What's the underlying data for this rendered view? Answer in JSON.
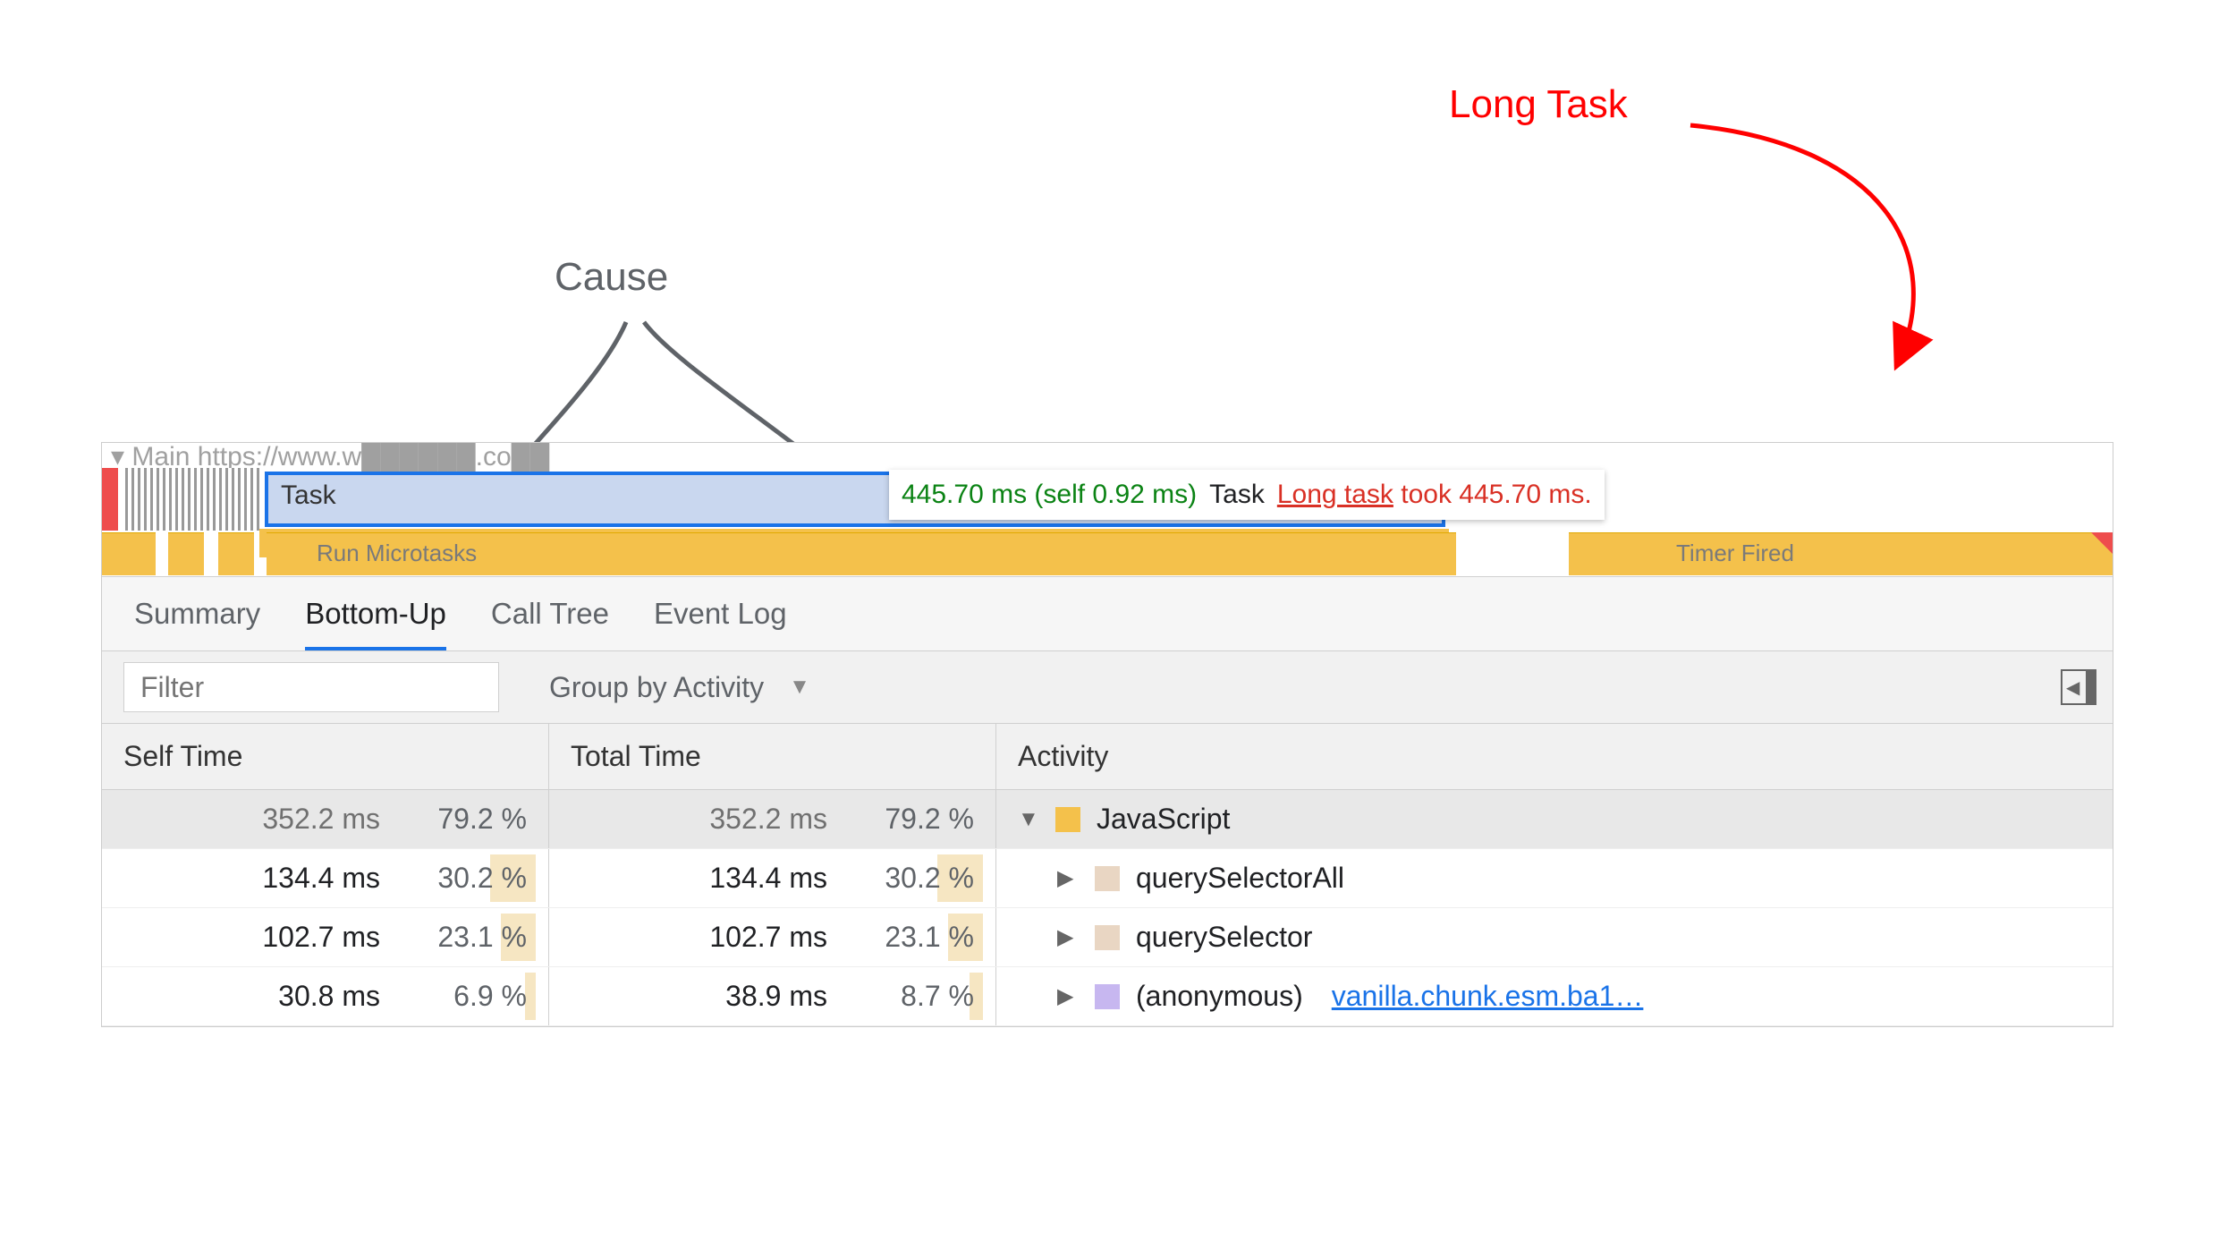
{
  "annotations": {
    "long_task": "Long Task",
    "cause": "Cause"
  },
  "flame": {
    "url_prefix": "▾ Main   https://www.w██████.co██",
    "task_label": "Task",
    "popup": {
      "time": "445.70 ms (self 0.92 ms)",
      "name": "Task",
      "warn_prefix": "Long task",
      "warn_suffix": " took 445.70 ms."
    },
    "sub_left": "Run Microtasks",
    "sub_right": "Timer Fired"
  },
  "tabs": [
    "Summary",
    "Bottom-Up",
    "Call Tree",
    "Event Log"
  ],
  "selected_tab": 1,
  "filter": {
    "placeholder": "Filter",
    "group_label": "Group by Activity"
  },
  "columns": [
    "Self Time",
    "Total Time",
    "Activity"
  ],
  "rows": [
    {
      "self_ms": "352.2 ms",
      "self_pct": "79.2 %",
      "self_bar": 0,
      "total_ms": "352.2 ms",
      "total_pct": "79.2 %",
      "total_bar": 0,
      "expander": "down",
      "swatch": "js",
      "name": "JavaScript",
      "link": "",
      "selected": true,
      "indent": 0
    },
    {
      "self_ms": "134.4 ms",
      "self_pct": "30.2 %",
      "self_bar": 30.2,
      "total_ms": "134.4 ms",
      "total_pct": "30.2 %",
      "total_bar": 30.2,
      "expander": "right",
      "swatch": "qs",
      "name": "querySelectorAll",
      "link": "",
      "selected": false,
      "indent": 1
    },
    {
      "self_ms": "102.7 ms",
      "self_pct": "23.1 %",
      "self_bar": 23.1,
      "total_ms": "102.7 ms",
      "total_pct": "23.1 %",
      "total_bar": 23.1,
      "expander": "right",
      "swatch": "qs",
      "name": "querySelector",
      "link": "",
      "selected": false,
      "indent": 1
    },
    {
      "self_ms": "30.8 ms",
      "self_pct": "6.9 %",
      "self_bar": 6.9,
      "total_ms": "38.9 ms",
      "total_pct": "8.7 %",
      "total_bar": 8.7,
      "expander": "right",
      "swatch": "anon",
      "name": "(anonymous)",
      "link": "vanilla.chunk.esm.ba1…",
      "selected": false,
      "indent": 1
    }
  ]
}
